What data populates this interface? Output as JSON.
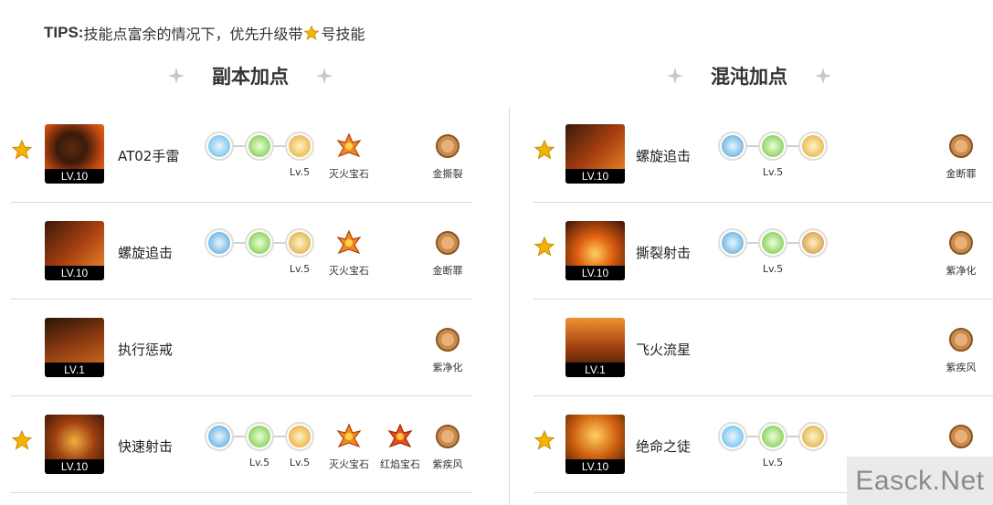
{
  "tips": {
    "prefix": "TIPS:",
    "text_before": "技能点富余的情况下，优先升级带",
    "text_after": "号技能"
  },
  "sections": {
    "dungeon_title": "副本加点",
    "chaos_title": "混沌加点"
  },
  "left_rows": [
    {
      "skill": "AT02手雷",
      "level": "LV.10",
      "starred": true,
      "rune_caps": [
        "",
        "",
        "Lv.5"
      ],
      "gems": [
        "灭火宝石"
      ],
      "badge": "金撕裂"
    },
    {
      "skill": "螺旋追击",
      "level": "LV.10",
      "starred": false,
      "rune_caps": [
        "",
        "",
        "Lv.5"
      ],
      "gems": [
        "灭火宝石"
      ],
      "badge": "金断罪"
    },
    {
      "skill": "执行惩戒",
      "level": "LV.1",
      "starred": false,
      "rune_caps": [],
      "gems": [],
      "badge": "紫净化"
    },
    {
      "skill": "快速射击",
      "level": "LV.10",
      "starred": true,
      "rune_caps": [
        "",
        "Lv.5",
        "Lv.5"
      ],
      "gems": [
        "灭火宝石",
        "红焰宝石"
      ],
      "badge": "紫疾风"
    }
  ],
  "right_rows": [
    {
      "skill": "螺旋追击",
      "level": "LV.10",
      "starred": true,
      "rune_caps": [
        "",
        "Lv.5",
        ""
      ],
      "badge": "金断罪"
    },
    {
      "skill": "撕裂射击",
      "level": "LV.10",
      "starred": true,
      "rune_caps": [
        "",
        "Lv.5",
        ""
      ],
      "badge": "紫净化"
    },
    {
      "skill": "飞火流星",
      "level": "LV.1",
      "starred": false,
      "rune_caps": [],
      "badge": "紫疾风"
    },
    {
      "skill": "绝命之徒",
      "level": "LV.10",
      "starred": true,
      "rune_caps": [
        "",
        "Lv.5",
        ""
      ],
      "badge": ""
    }
  ],
  "watermark": "Easck.Net",
  "icons": {
    "star": "star-icon",
    "deco": "sparkle-icon",
    "gem": "fire-gem-icon",
    "badge": "bronze-badge-icon"
  },
  "colors": {
    "star": "#f5b301",
    "divider": "#d8d8d8",
    "lv_bg": "#000000"
  }
}
